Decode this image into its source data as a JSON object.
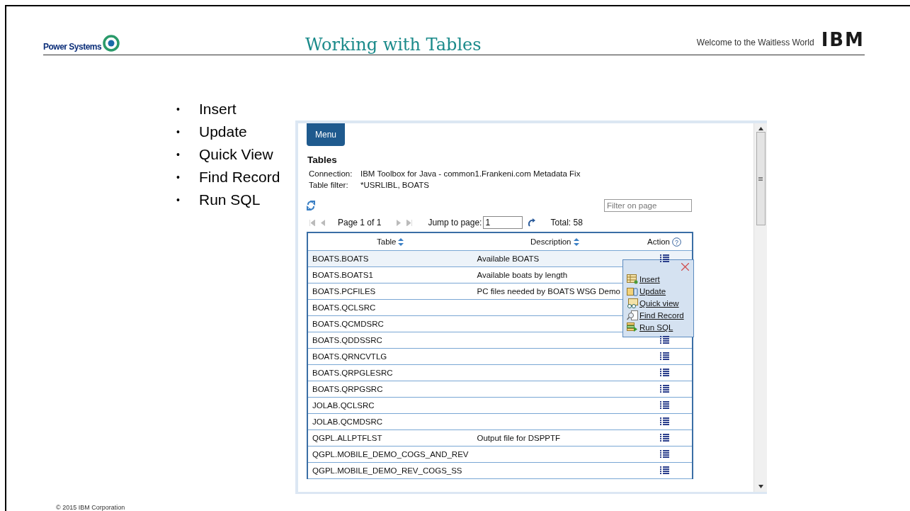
{
  "header": {
    "logo_text": "Power Systems",
    "title": "Working with Tables",
    "tagline": "Welcome to the Waitless World",
    "brand": "IBM"
  },
  "bullets": [
    {
      "marker": "•",
      "text": "Insert"
    },
    {
      "marker": "•",
      "text": "Update"
    },
    {
      "marker": "•",
      "text": "Quick View"
    },
    {
      "marker": "•",
      "text": "Find Record"
    },
    {
      "marker": "•",
      "text": "Run SQL"
    }
  ],
  "app": {
    "menu_button": "Menu",
    "heading": "Tables",
    "info": [
      {
        "label": "Connection:",
        "value": "IBM Toolbox for Java - common1.Frankeni.com Metadata Fix"
      },
      {
        "label": "Table filter:",
        "value": "*USRLIBL, BOATS"
      }
    ],
    "filter": {
      "placeholder": "Filter on page"
    },
    "pager": {
      "page_text": "Page 1 of 1",
      "jump_label": "Jump to page:",
      "jump_value": "1",
      "total": "Total: 58"
    },
    "table": {
      "columns": [
        "Table",
        "Description",
        "Action"
      ],
      "help_mark": "?",
      "rows": [
        {
          "table": "BOATS.BOATS",
          "description": "Available BOATS",
          "selected": true,
          "action_hidden": false
        },
        {
          "table": "BOATS.BOATS1",
          "description": "Available boats by length",
          "selected": false,
          "action_hidden": true
        },
        {
          "table": "BOATS.PCFILES",
          "description": "PC files needed by BOATS WSG Demo",
          "selected": false,
          "action_hidden": true
        },
        {
          "table": "BOATS.QCLSRC",
          "selected": false,
          "action_hidden": true
        },
        {
          "table": "BOATS.QCMDSRC",
          "selected": false,
          "action_hidden": true
        },
        {
          "table": "BOATS.QDDSSRC",
          "selected": false,
          "action_hidden": false
        },
        {
          "table": "BOATS.QRNCVTLG",
          "selected": false,
          "action_hidden": false
        },
        {
          "table": "BOATS.QRPGLESRC",
          "selected": false,
          "action_hidden": false
        },
        {
          "table": "BOATS.QRPGSRC",
          "selected": false,
          "action_hidden": false
        },
        {
          "table": "JOLAB.QCLSRC",
          "selected": false,
          "action_hidden": false
        },
        {
          "table": "JOLAB.QCMDSRC",
          "selected": false,
          "action_hidden": false
        },
        {
          "table": "QGPL.ALLPTFLST",
          "description": "Output file for DSPPTF",
          "selected": false,
          "action_hidden": false
        },
        {
          "table": "QGPL.MOBILE_DEMO_COGS_AND_REV",
          "selected": false,
          "action_hidden": false
        },
        {
          "table": "QGPL.MOBILE_DEMO_REV_COGS_SS",
          "selected": false,
          "action_hidden": false
        }
      ]
    },
    "popup": [
      {
        "kind": "insert",
        "label": "Insert"
      },
      {
        "kind": "update",
        "label": "Update"
      },
      {
        "kind": "quickview",
        "label": "Quick view"
      },
      {
        "kind": "find",
        "label": "Find Record"
      },
      {
        "kind": "sql",
        "label": "Run SQL"
      }
    ]
  },
  "footer": "© 2015 IBM Corporation"
}
